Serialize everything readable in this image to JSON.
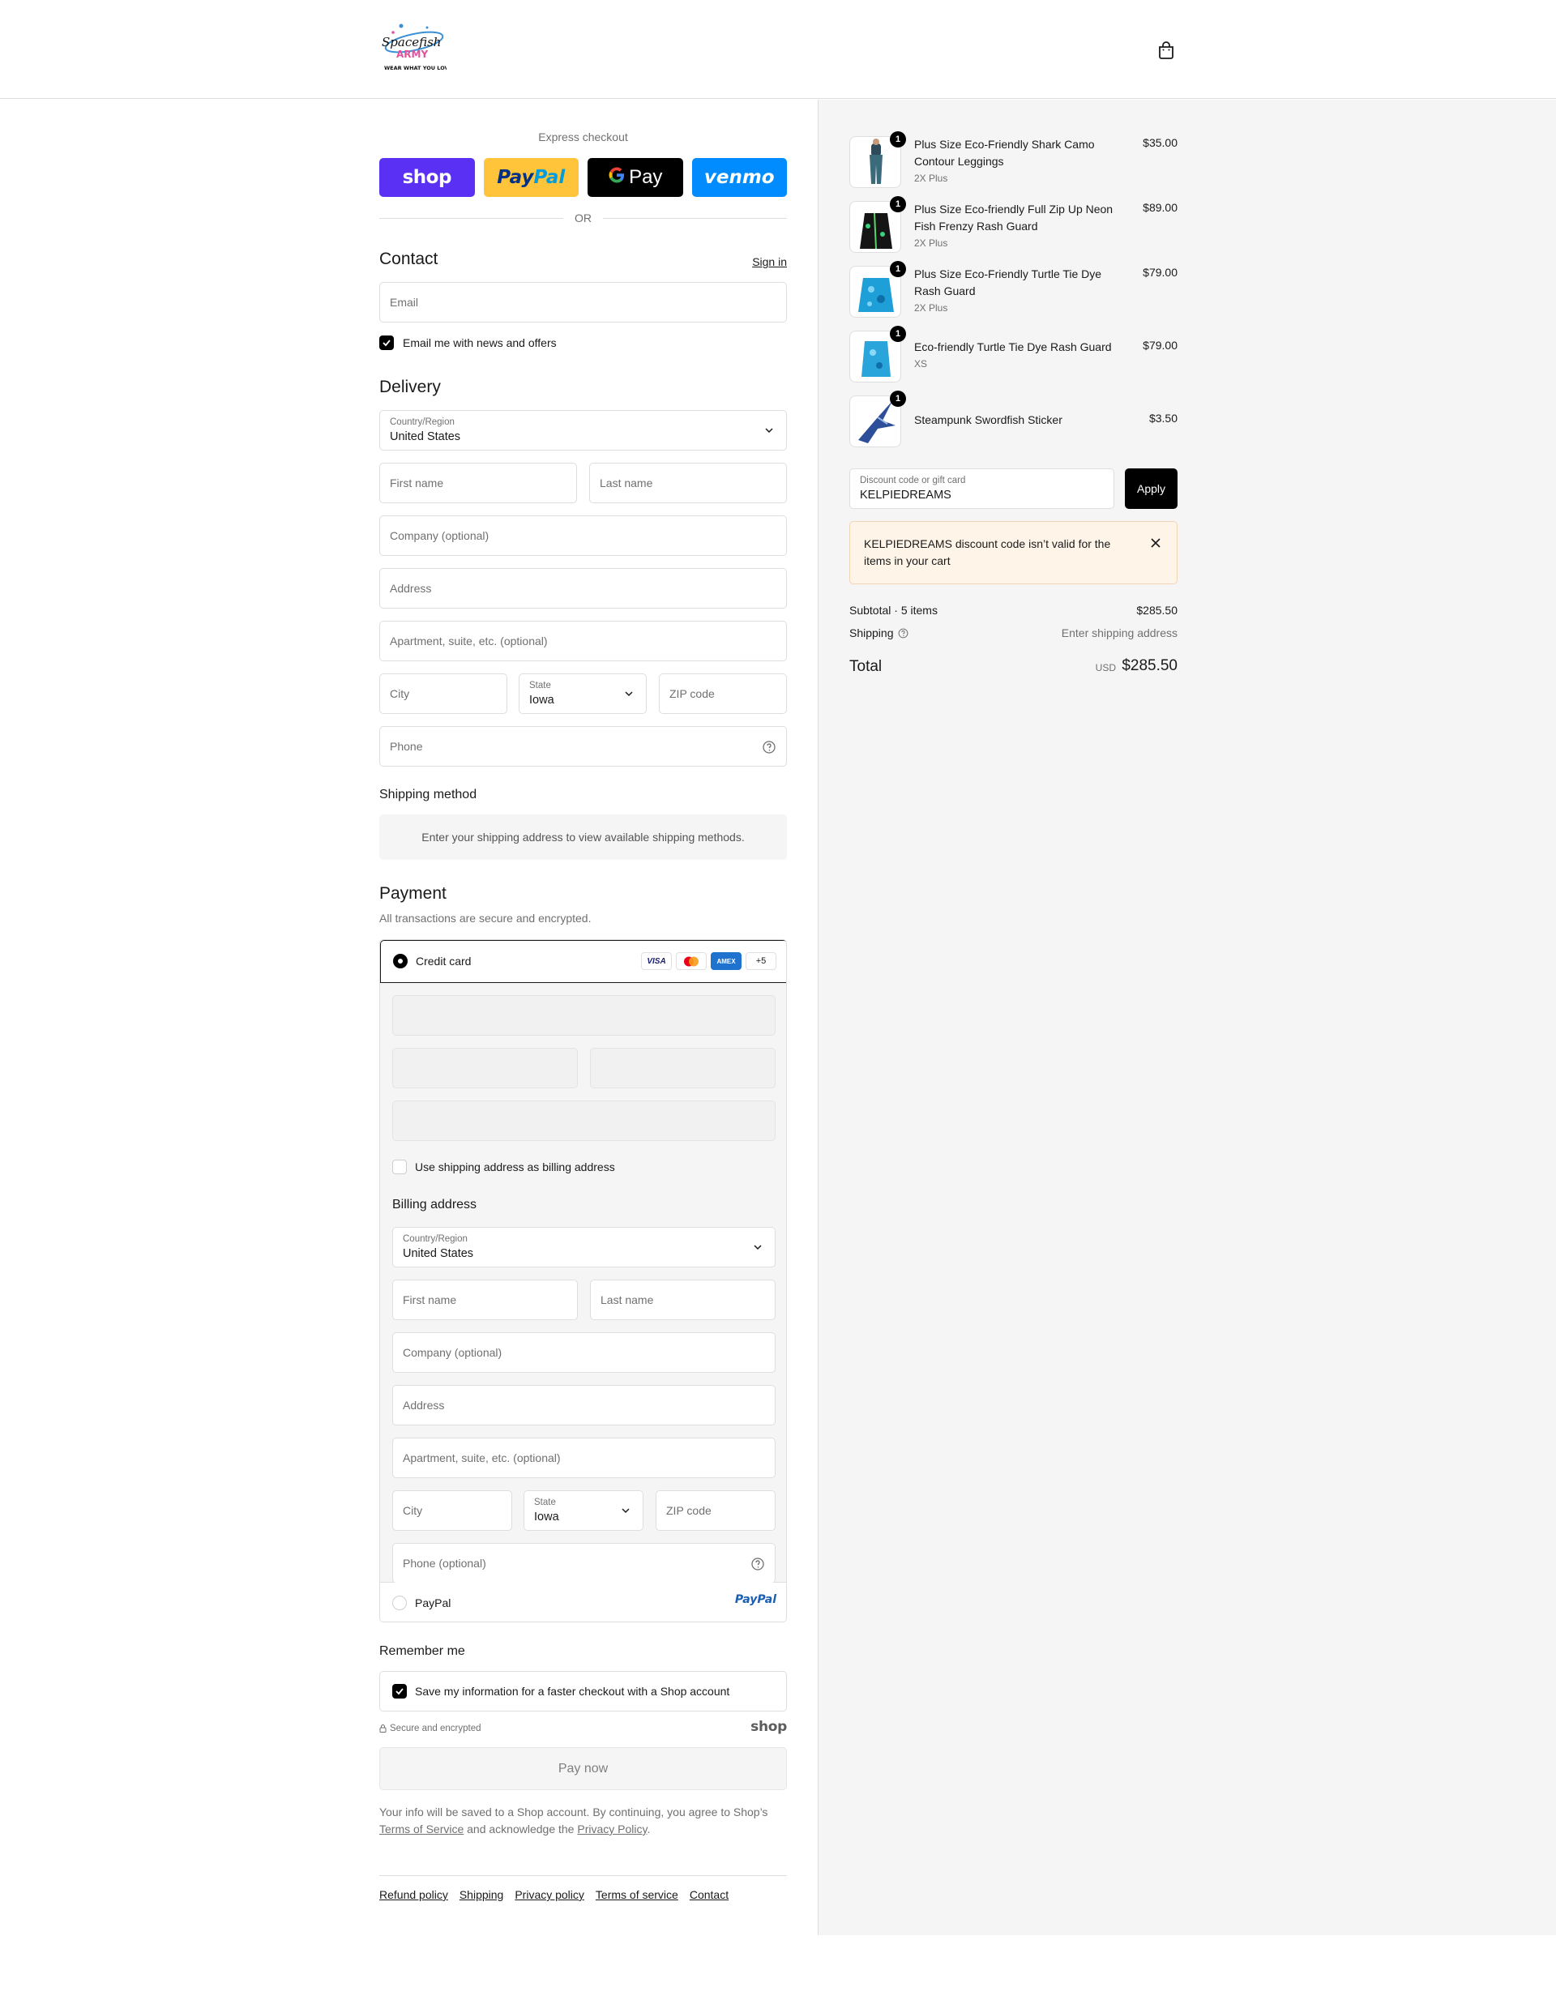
{
  "header": {
    "logo_text_1": "Spacefish",
    "logo_text_2": "ARMY",
    "logo_tagline": "WEAR WHAT YOU LOVE",
    "cart_icon": "shopping-bag-icon"
  },
  "express": {
    "title": "Express checkout",
    "shop_label": "shop",
    "paypal_label_1": "Pay",
    "paypal_label_2": "Pal",
    "gpay_label": "Pay",
    "venmo_label": "venmo",
    "or_label": "OR"
  },
  "contact": {
    "title": "Contact",
    "sign_in": "Sign in",
    "email_placeholder": "Email",
    "news_label": "Email me with news and offers"
  },
  "delivery": {
    "title": "Delivery",
    "country_label": "Country/Region",
    "country_value": "United States",
    "first_name": "First name",
    "last_name": "Last name",
    "company": "Company (optional)",
    "address": "Address",
    "apartment": "Apartment, suite, etc. (optional)",
    "city": "City",
    "state_label": "State",
    "state_value": "Iowa",
    "zip": "ZIP code",
    "phone": "Phone"
  },
  "shipping_method": {
    "title": "Shipping method",
    "info": "Enter your shipping address to view available shipping methods."
  },
  "payment": {
    "title": "Payment",
    "subtitle": "All transactions are secure and encrypted.",
    "credit_card_label": "Credit card",
    "brands": [
      "VISA",
      "mastercard",
      "AMEX",
      "+5"
    ],
    "same_billing_label": "Use shipping address as billing address",
    "paypal_label": "PayPal",
    "paypal_logo": "PayPal"
  },
  "billing": {
    "title": "Billing address",
    "country_label": "Country/Region",
    "country_value": "United States",
    "first_name": "First name",
    "last_name": "Last name",
    "company": "Company (optional)",
    "address": "Address",
    "apartment": "Apartment, suite, etc. (optional)",
    "city": "City",
    "state_label": "State",
    "state_value": "Iowa",
    "zip": "ZIP code",
    "phone": "Phone (optional)"
  },
  "remember": {
    "title": "Remember me",
    "save_label": "Save my information for a faster checkout with a Shop account",
    "secure_label": "Secure and encrypted",
    "shop_mark": "shop"
  },
  "pay_now": "Pay now",
  "legal": {
    "text_1": "Your info will be saved to a Shop account. By continuing, you agree to Shop’s",
    "tos": "Terms of Service",
    "text_2": "and acknowledge the",
    "privacy": "Privacy Policy",
    "text_3": "."
  },
  "footer": {
    "links": [
      "Refund policy",
      "Shipping",
      "Privacy policy",
      "Terms of service",
      "Contact"
    ]
  },
  "summary": {
    "items": [
      {
        "qty": "1",
        "name": "Plus Size Eco-Friendly Shark Camo Contour Leggings",
        "variant": "2X Plus",
        "price": "$35.00"
      },
      {
        "qty": "1",
        "name": "Plus Size Eco-friendly Full Zip Up Neon Fish Frenzy Rash Guard",
        "variant": "2X Plus",
        "price": "$89.00"
      },
      {
        "qty": "1",
        "name": "Plus Size Eco-Friendly Turtle Tie Dye Rash Guard",
        "variant": "2X Plus",
        "price": "$79.00"
      },
      {
        "qty": "1",
        "name": "Eco-friendly Turtle Tie Dye Rash Guard",
        "variant": "XS",
        "price": "$79.00"
      },
      {
        "qty": "1",
        "name": "Steampunk Swordfish Sticker",
        "variant": "",
        "price": "$3.50"
      }
    ],
    "discount_label": "Discount code or gift card",
    "discount_value": "KELPIEDREAMS",
    "apply_label": "Apply",
    "error_text": "KELPIEDREAMS discount code isn’t valid for the items in your cart",
    "subtotal_label": "Subtotal · 5 items",
    "subtotal_value": "$285.50",
    "shipping_label": "Shipping",
    "shipping_value": "Enter shipping address",
    "total_label": "Total",
    "currency": "USD",
    "total_value": "$285.50"
  },
  "colors": {
    "shop": "#5a31f4",
    "paypal": "#ffc439",
    "venmo": "#008cff",
    "error_bg": "#fff4e8"
  }
}
